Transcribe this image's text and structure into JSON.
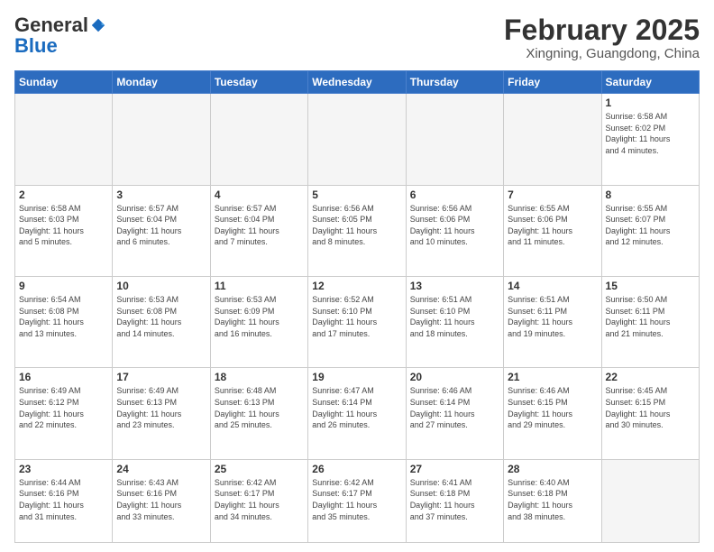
{
  "header": {
    "logo_general": "General",
    "logo_blue": "Blue",
    "month_title": "February 2025",
    "location": "Xingning, Guangdong, China"
  },
  "days_of_week": [
    "Sunday",
    "Monday",
    "Tuesday",
    "Wednesday",
    "Thursday",
    "Friday",
    "Saturday"
  ],
  "weeks": [
    [
      {
        "day": "",
        "info": "",
        "empty": true
      },
      {
        "day": "",
        "info": "",
        "empty": true
      },
      {
        "day": "",
        "info": "",
        "empty": true
      },
      {
        "day": "",
        "info": "",
        "empty": true
      },
      {
        "day": "",
        "info": "",
        "empty": true
      },
      {
        "day": "",
        "info": "",
        "empty": true
      },
      {
        "day": "1",
        "info": "Sunrise: 6:58 AM\nSunset: 6:02 PM\nDaylight: 11 hours\nand 4 minutes."
      }
    ],
    [
      {
        "day": "2",
        "info": "Sunrise: 6:58 AM\nSunset: 6:03 PM\nDaylight: 11 hours\nand 5 minutes."
      },
      {
        "day": "3",
        "info": "Sunrise: 6:57 AM\nSunset: 6:04 PM\nDaylight: 11 hours\nand 6 minutes."
      },
      {
        "day": "4",
        "info": "Sunrise: 6:57 AM\nSunset: 6:04 PM\nDaylight: 11 hours\nand 7 minutes."
      },
      {
        "day": "5",
        "info": "Sunrise: 6:56 AM\nSunset: 6:05 PM\nDaylight: 11 hours\nand 8 minutes."
      },
      {
        "day": "6",
        "info": "Sunrise: 6:56 AM\nSunset: 6:06 PM\nDaylight: 11 hours\nand 10 minutes."
      },
      {
        "day": "7",
        "info": "Sunrise: 6:55 AM\nSunset: 6:06 PM\nDaylight: 11 hours\nand 11 minutes."
      },
      {
        "day": "8",
        "info": "Sunrise: 6:55 AM\nSunset: 6:07 PM\nDaylight: 11 hours\nand 12 minutes."
      }
    ],
    [
      {
        "day": "9",
        "info": "Sunrise: 6:54 AM\nSunset: 6:08 PM\nDaylight: 11 hours\nand 13 minutes."
      },
      {
        "day": "10",
        "info": "Sunrise: 6:53 AM\nSunset: 6:08 PM\nDaylight: 11 hours\nand 14 minutes."
      },
      {
        "day": "11",
        "info": "Sunrise: 6:53 AM\nSunset: 6:09 PM\nDaylight: 11 hours\nand 16 minutes."
      },
      {
        "day": "12",
        "info": "Sunrise: 6:52 AM\nSunset: 6:10 PM\nDaylight: 11 hours\nand 17 minutes."
      },
      {
        "day": "13",
        "info": "Sunrise: 6:51 AM\nSunset: 6:10 PM\nDaylight: 11 hours\nand 18 minutes."
      },
      {
        "day": "14",
        "info": "Sunrise: 6:51 AM\nSunset: 6:11 PM\nDaylight: 11 hours\nand 19 minutes."
      },
      {
        "day": "15",
        "info": "Sunrise: 6:50 AM\nSunset: 6:11 PM\nDaylight: 11 hours\nand 21 minutes."
      }
    ],
    [
      {
        "day": "16",
        "info": "Sunrise: 6:49 AM\nSunset: 6:12 PM\nDaylight: 11 hours\nand 22 minutes."
      },
      {
        "day": "17",
        "info": "Sunrise: 6:49 AM\nSunset: 6:13 PM\nDaylight: 11 hours\nand 23 minutes."
      },
      {
        "day": "18",
        "info": "Sunrise: 6:48 AM\nSunset: 6:13 PM\nDaylight: 11 hours\nand 25 minutes."
      },
      {
        "day": "19",
        "info": "Sunrise: 6:47 AM\nSunset: 6:14 PM\nDaylight: 11 hours\nand 26 minutes."
      },
      {
        "day": "20",
        "info": "Sunrise: 6:46 AM\nSunset: 6:14 PM\nDaylight: 11 hours\nand 27 minutes."
      },
      {
        "day": "21",
        "info": "Sunrise: 6:46 AM\nSunset: 6:15 PM\nDaylight: 11 hours\nand 29 minutes."
      },
      {
        "day": "22",
        "info": "Sunrise: 6:45 AM\nSunset: 6:15 PM\nDaylight: 11 hours\nand 30 minutes."
      }
    ],
    [
      {
        "day": "23",
        "info": "Sunrise: 6:44 AM\nSunset: 6:16 PM\nDaylight: 11 hours\nand 31 minutes."
      },
      {
        "day": "24",
        "info": "Sunrise: 6:43 AM\nSunset: 6:16 PM\nDaylight: 11 hours\nand 33 minutes."
      },
      {
        "day": "25",
        "info": "Sunrise: 6:42 AM\nSunset: 6:17 PM\nDaylight: 11 hours\nand 34 minutes."
      },
      {
        "day": "26",
        "info": "Sunrise: 6:42 AM\nSunset: 6:17 PM\nDaylight: 11 hours\nand 35 minutes."
      },
      {
        "day": "27",
        "info": "Sunrise: 6:41 AM\nSunset: 6:18 PM\nDaylight: 11 hours\nand 37 minutes."
      },
      {
        "day": "28",
        "info": "Sunrise: 6:40 AM\nSunset: 6:18 PM\nDaylight: 11 hours\nand 38 minutes."
      },
      {
        "day": "",
        "info": "",
        "empty": true
      }
    ]
  ]
}
